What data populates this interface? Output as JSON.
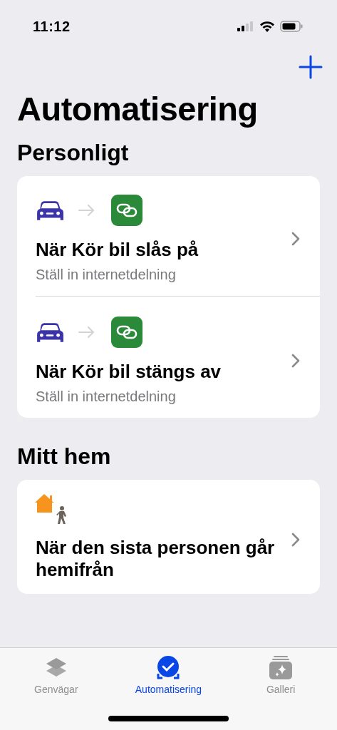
{
  "status_bar": {
    "time": "11:12"
  },
  "title": "Automatisering",
  "sections": [
    {
      "title": "Personligt",
      "items": [
        {
          "kind": "vehicle",
          "title": "När Kör bil slås på",
          "subtitle": "Ställ in internetdelning"
        },
        {
          "kind": "vehicle",
          "title": "När Kör bil stängs av",
          "subtitle": "Ställ in internetdelning"
        }
      ]
    },
    {
      "title": "Mitt hem",
      "items": [
        {
          "kind": "home",
          "title": "När den sista personen går hemifrån"
        }
      ]
    }
  ],
  "tabs": [
    {
      "kind": "shortcuts",
      "label": "Genvägar",
      "selected": false
    },
    {
      "kind": "automation",
      "label": "Automatisering",
      "selected": true
    },
    {
      "kind": "gallery",
      "label": "Galleri",
      "selected": false
    }
  ]
}
